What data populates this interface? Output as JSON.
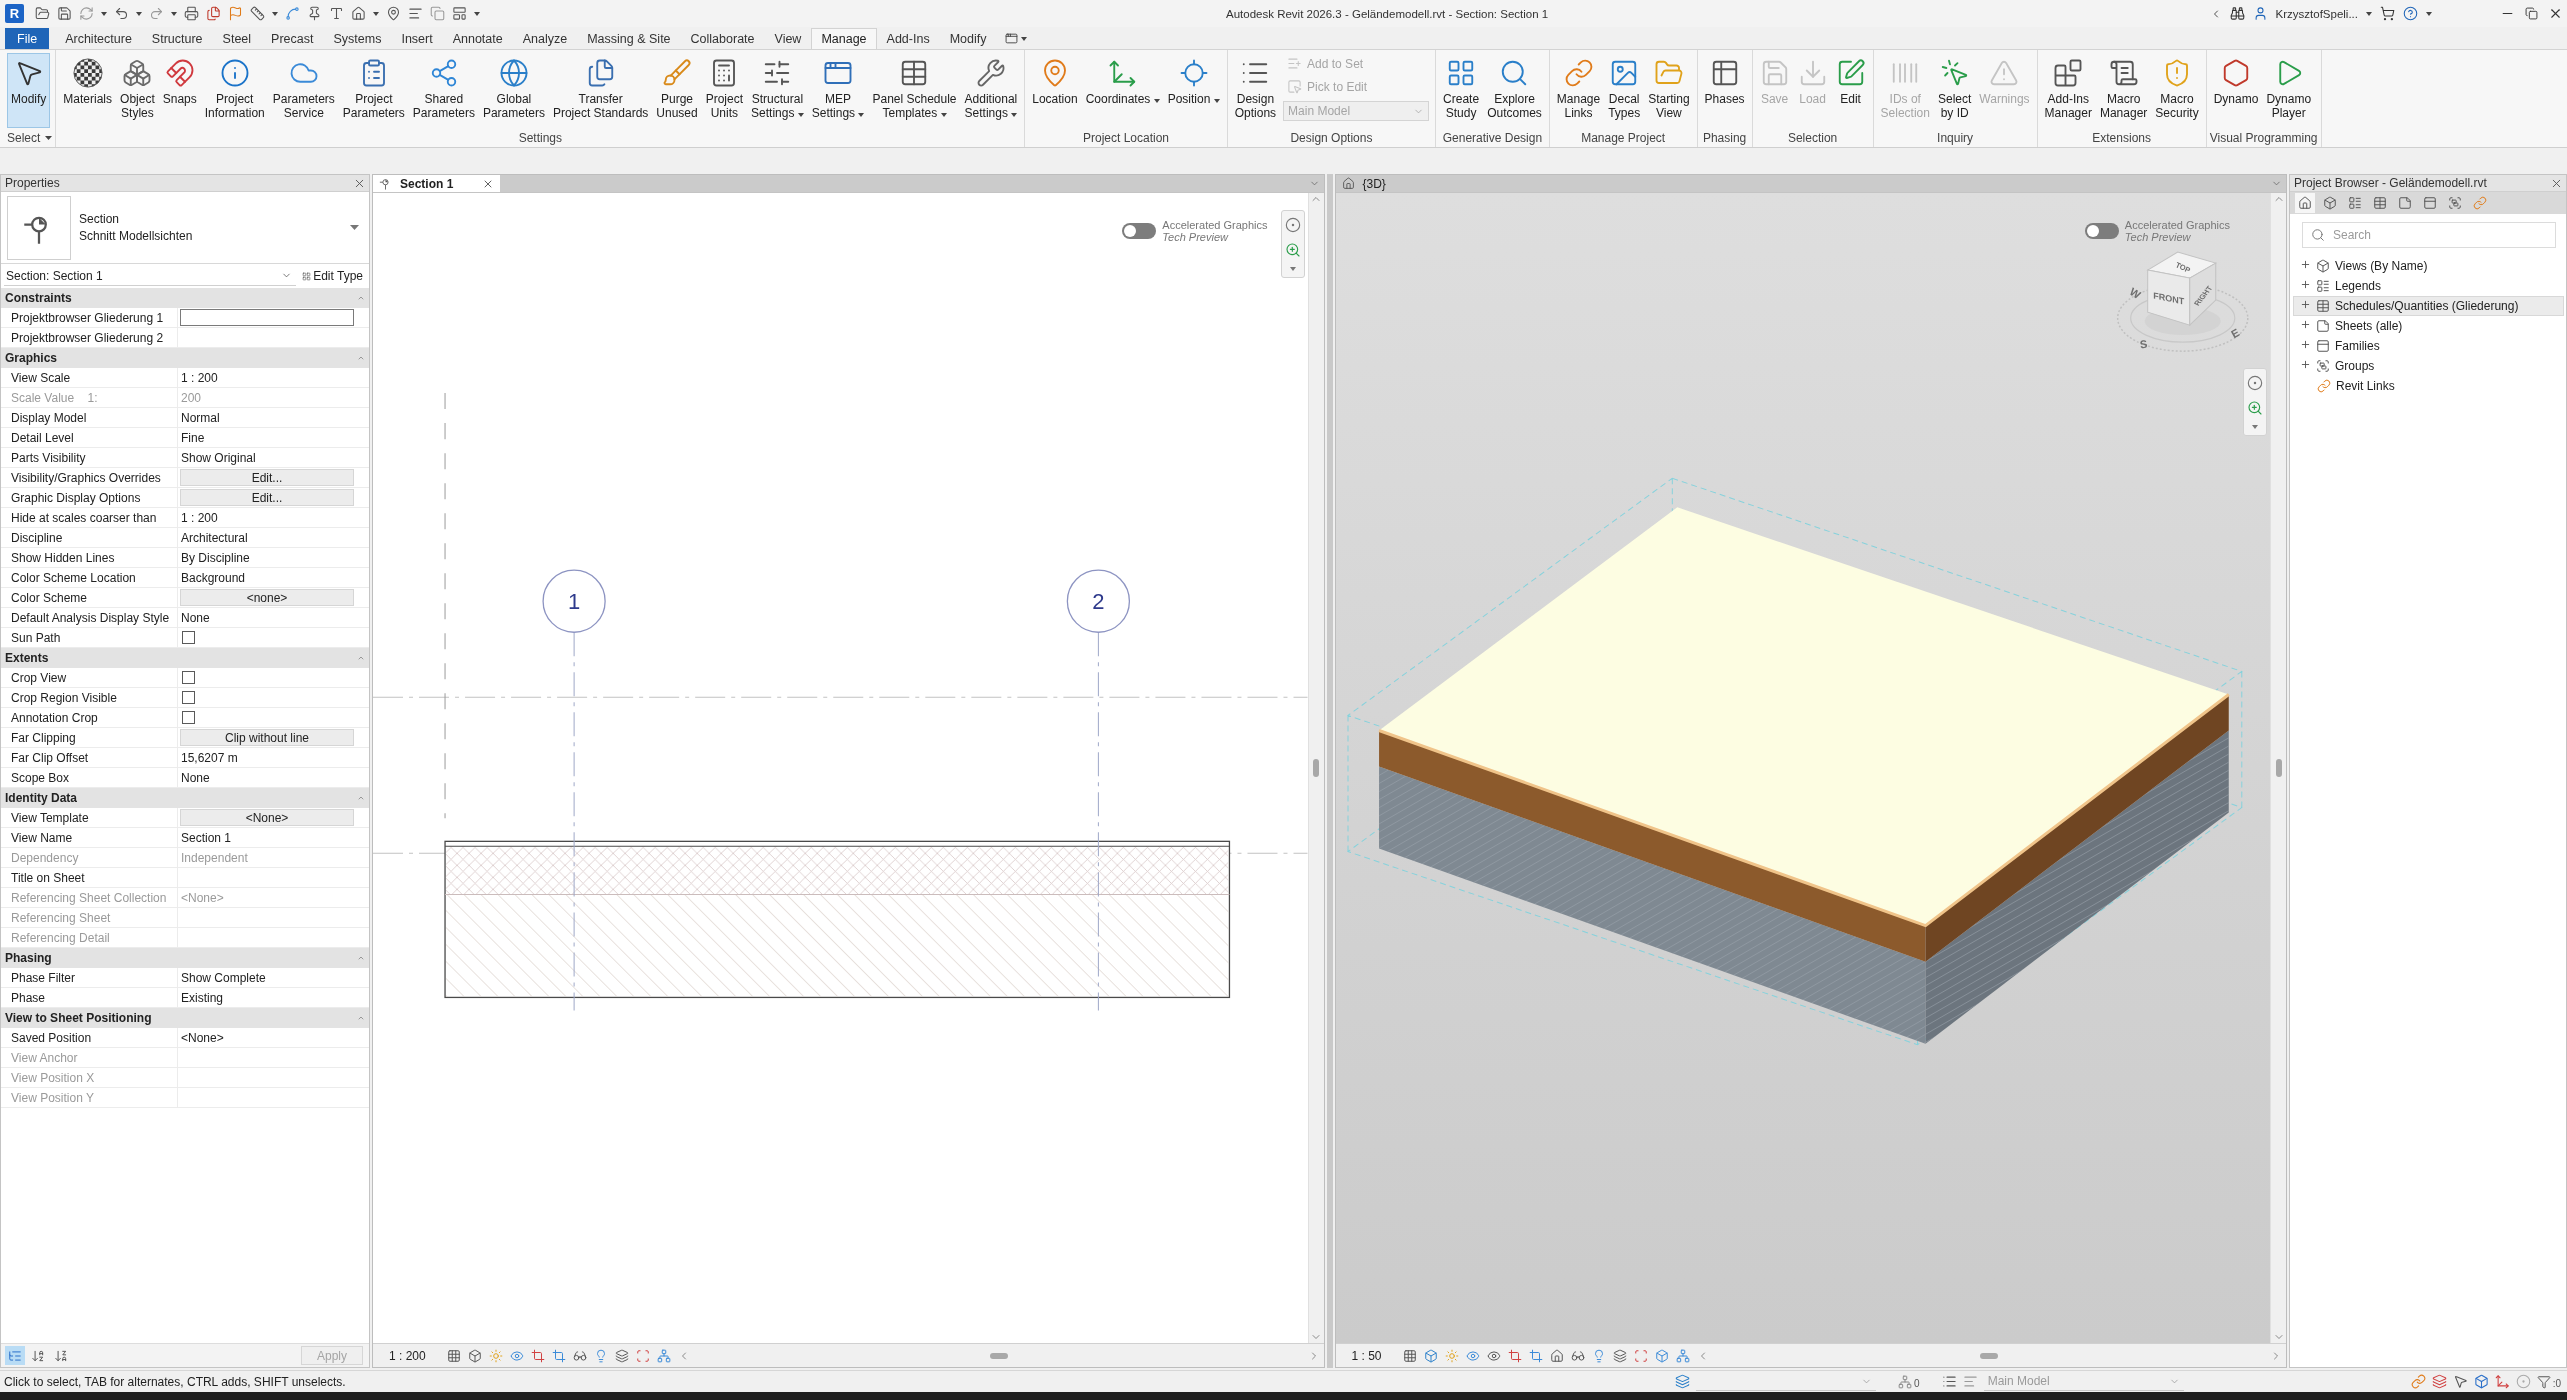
{
  "title_bar": {
    "logo": "R",
    "title": "Autodesk Revit 2026.3 - Geländemodell.rvt - Section: Section 1",
    "user": "KrzysztofSpeli..."
  },
  "ribbon_tabs": [
    {
      "label": "File",
      "kind": "file",
      "selected": false
    },
    {
      "label": "Architecture",
      "kind": "tab",
      "selected": false
    },
    {
      "label": "Structure",
      "kind": "tab",
      "selected": false
    },
    {
      "label": "Steel",
      "kind": "tab",
      "selected": false
    },
    {
      "label": "Precast",
      "kind": "tab",
      "selected": false
    },
    {
      "label": "Systems",
      "kind": "tab",
      "selected": false
    },
    {
      "label": "Insert",
      "kind": "tab",
      "selected": false
    },
    {
      "label": "Annotate",
      "kind": "tab",
      "selected": false
    },
    {
      "label": "Analyze",
      "kind": "tab",
      "selected": false
    },
    {
      "label": "Massing & Site",
      "kind": "tab",
      "selected": false
    },
    {
      "label": "Collaborate",
      "kind": "tab",
      "selected": false
    },
    {
      "label": "View",
      "kind": "tab",
      "selected": false
    },
    {
      "label": "Manage",
      "kind": "tab",
      "selected": true
    },
    {
      "label": "Add-Ins",
      "kind": "tab",
      "selected": false
    },
    {
      "label": "Modify",
      "kind": "tab",
      "selected": false
    }
  ],
  "ribbon_panels": [
    {
      "title": "Select",
      "menu": true,
      "buttons": [
        {
          "label": "Modify",
          "kind": "large",
          "active": true,
          "disabled": false,
          "dropdown": false
        }
      ]
    },
    {
      "title": "Settings",
      "menu": false,
      "buttons": [
        {
          "label": "Materials",
          "kind": "large",
          "active": false,
          "disabled": false,
          "dropdown": false
        },
        {
          "label": "Object\nStyles",
          "kind": "large",
          "active": false,
          "disabled": false,
          "dropdown": false
        },
        {
          "label": "Snaps",
          "kind": "large",
          "active": false,
          "disabled": false,
          "dropdown": false
        },
        {
          "label": "Project\nInformation",
          "kind": "large",
          "active": false,
          "disabled": false,
          "dropdown": false
        },
        {
          "label": "Parameters\nService",
          "kind": "large",
          "active": false,
          "disabled": false,
          "dropdown": false
        },
        {
          "label": "Project\nParameters",
          "kind": "large",
          "active": false,
          "disabled": false,
          "dropdown": false
        },
        {
          "label": "Shared\nParameters",
          "kind": "large",
          "active": false,
          "disabled": false,
          "dropdown": false
        },
        {
          "label": "Global\nParameters",
          "kind": "large",
          "active": false,
          "disabled": false,
          "dropdown": false
        },
        {
          "label": "Transfer\nProject Standards",
          "kind": "large",
          "active": false,
          "disabled": false,
          "dropdown": false
        },
        {
          "label": "Purge\nUnused",
          "kind": "large",
          "active": false,
          "disabled": false,
          "dropdown": false
        },
        {
          "label": "Project\nUnits",
          "kind": "large",
          "active": false,
          "disabled": false,
          "dropdown": false
        },
        {
          "label": "Structural\nSettings",
          "kind": "large",
          "active": false,
          "disabled": false,
          "dropdown": true
        },
        {
          "label": "MEP\nSettings",
          "kind": "large",
          "active": false,
          "disabled": false,
          "dropdown": true
        },
        {
          "label": "Panel Schedule\nTemplates",
          "kind": "large",
          "active": false,
          "disabled": false,
          "dropdown": true
        },
        {
          "label": "Additional\nSettings",
          "kind": "large",
          "active": false,
          "disabled": false,
          "dropdown": true
        }
      ]
    },
    {
      "title": "Project Location",
      "menu": false,
      "buttons": [
        {
          "label": "Location",
          "kind": "large",
          "active": false,
          "disabled": false,
          "dropdown": false
        },
        {
          "label": "Coordinates",
          "kind": "large",
          "active": false,
          "disabled": false,
          "dropdown": true
        },
        {
          "label": "Position",
          "kind": "large",
          "active": false,
          "disabled": false,
          "dropdown": true
        }
      ]
    },
    {
      "title": "Design Options",
      "menu": false,
      "buttons": [
        {
          "label": "Design\nOptions",
          "kind": "large",
          "active": false,
          "disabled": false,
          "dropdown": false
        },
        {
          "label": "Add to Set",
          "kind": "small",
          "active": false,
          "disabled": true,
          "dropdown": false
        },
        {
          "label": "Pick to Edit",
          "kind": "small",
          "active": false,
          "disabled": true,
          "dropdown": false
        },
        {
          "label": "Main Model",
          "kind": "field",
          "disabled": true,
          "dropdown": true
        }
      ]
    },
    {
      "title": "Generative Design",
      "menu": false,
      "buttons": [
        {
          "label": "Create\nStudy",
          "kind": "large",
          "active": false,
          "disabled": false,
          "dropdown": false
        },
        {
          "label": "Explore\nOutcomes",
          "kind": "large",
          "active": false,
          "disabled": false,
          "dropdown": false
        }
      ]
    },
    {
      "title": "Manage Project",
      "menu": false,
      "buttons": [
        {
          "label": "Manage\nLinks",
          "kind": "large",
          "active": false,
          "disabled": false,
          "dropdown": false
        },
        {
          "label": "Decal\nTypes",
          "kind": "large",
          "active": false,
          "disabled": false,
          "dropdown": false
        },
        {
          "label": "Starting\nView",
          "kind": "large",
          "active": false,
          "disabled": false,
          "dropdown": false
        }
      ]
    },
    {
      "title": "Phasing",
      "menu": false,
      "buttons": [
        {
          "label": "Phases",
          "kind": "large",
          "active": false,
          "disabled": false,
          "dropdown": false
        }
      ]
    },
    {
      "title": "Selection",
      "menu": false,
      "buttons": [
        {
          "label": "Save",
          "kind": "large",
          "active": false,
          "disabled": true,
          "dropdown": false
        },
        {
          "label": "Load",
          "kind": "large",
          "active": false,
          "disabled": true,
          "dropdown": false
        },
        {
          "label": "Edit",
          "kind": "large",
          "active": false,
          "disabled": false,
          "dropdown": false
        }
      ]
    },
    {
      "title": "Inquiry",
      "menu": false,
      "buttons": [
        {
          "label": "IDs of\nSelection",
          "kind": "large",
          "active": false,
          "disabled": true,
          "dropdown": false
        },
        {
          "label": "Select\nby ID",
          "kind": "large",
          "active": false,
          "disabled": false,
          "dropdown": false
        },
        {
          "label": "Warnings",
          "kind": "large",
          "active": false,
          "disabled": true,
          "dropdown": false
        }
      ]
    },
    {
      "title": "Extensions",
      "menu": false,
      "buttons": [
        {
          "label": "Add-Ins\nManager",
          "kind": "large",
          "active": false,
          "disabled": false,
          "dropdown": false
        },
        {
          "label": "Macro\nManager",
          "kind": "large",
          "active": false,
          "disabled": false,
          "dropdown": false
        },
        {
          "label": "Macro\nSecurity",
          "kind": "large",
          "active": false,
          "disabled": false,
          "dropdown": false
        }
      ]
    },
    {
      "title": "Visual Programming",
      "menu": false,
      "buttons": [
        {
          "label": "Dynamo",
          "kind": "large",
          "active": false,
          "disabled": false,
          "dropdown": false
        },
        {
          "label": "Dynamo\nPlayer",
          "kind": "large",
          "active": false,
          "disabled": false,
          "dropdown": false
        }
      ]
    }
  ],
  "properties": {
    "title": "Properties",
    "type_family": "Section",
    "type_name": "Schnitt Modellsichten",
    "instance": "Section: Section 1",
    "edit_type": "Edit Type",
    "groups": [
      {
        "title": "Constraints",
        "rows": [
          {
            "name": "Projektbrowser Gliederung 1",
            "kind": "input",
            "disabled": false
          },
          {
            "name": "Projektbrowser Gliederung 2",
            "kind": "text",
            "disabled": false
          }
        ]
      },
      {
        "title": "Graphics",
        "rows": [
          {
            "name": "View Scale",
            "value": "1 : 200",
            "kind": "text",
            "disabled": false
          },
          {
            "name": "Scale Value    1:",
            "value": "200",
            "kind": "text",
            "disabled": true
          },
          {
            "name": "Display Model",
            "value": "Normal",
            "kind": "text",
            "disabled": false
          },
          {
            "name": "Detail Level",
            "value": "Fine",
            "kind": "text",
            "disabled": false
          },
          {
            "name": "Parts Visibility",
            "value": "Show Original",
            "kind": "text",
            "disabled": false
          },
          {
            "name": "Visibility/Graphics Overrides",
            "value": "Edit...",
            "kind": "button",
            "disabled": false
          },
          {
            "name": "Graphic Display Options",
            "value": "Edit...",
            "kind": "button",
            "disabled": false
          },
          {
            "name": "Hide at scales coarser than",
            "value": "1 : 200",
            "kind": "text",
            "disabled": false
          },
          {
            "name": "Discipline",
            "value": "Architectural",
            "kind": "text",
            "disabled": false
          },
          {
            "name": "Show Hidden Lines",
            "value": "By Discipline",
            "kind": "text",
            "disabled": false
          },
          {
            "name": "Color Scheme Location",
            "value": "Background",
            "kind": "text",
            "disabled": false
          },
          {
            "name": "Color Scheme",
            "value": "<none>",
            "kind": "button",
            "disabled": false
          },
          {
            "name": "Default Analysis Display Style",
            "value": "None",
            "kind": "text",
            "disabled": false
          },
          {
            "name": "Sun Path",
            "kind": "checkbox",
            "checked": false,
            "disabled": false
          }
        ]
      },
      {
        "title": "Extents",
        "rows": [
          {
            "name": "Crop View",
            "kind": "checkbox",
            "checked": false,
            "disabled": false
          },
          {
            "name": "Crop Region Visible",
            "kind": "checkbox",
            "checked": false,
            "disabled": false
          },
          {
            "name": "Annotation Crop",
            "kind": "checkbox",
            "checked": false,
            "disabled": false
          },
          {
            "name": "Far Clipping",
            "value": "Clip without line",
            "kind": "button",
            "disabled": false
          },
          {
            "name": "Far Clip Offset",
            "value": "15,6207 m",
            "kind": "text",
            "disabled": false
          },
          {
            "name": "Scope Box",
            "value": "None",
            "kind": "text",
            "disabled": false
          }
        ]
      },
      {
        "title": "Identity Data",
        "rows": [
          {
            "name": "View Template",
            "value": "<None>",
            "kind": "button",
            "disabled": false
          },
          {
            "name": "View Name",
            "value": "Section 1",
            "kind": "text",
            "disabled": false
          },
          {
            "name": "Dependency",
            "value": "Independent",
            "kind": "text",
            "disabled": true
          },
          {
            "name": "Title on Sheet",
            "kind": "text",
            "disabled": false
          },
          {
            "name": "Referencing Sheet Collection",
            "value": "<None>",
            "kind": "text",
            "disabled": true
          },
          {
            "name": "Referencing Sheet",
            "kind": "text",
            "disabled": true
          },
          {
            "name": "Referencing Detail",
            "kind": "text",
            "disabled": true
          }
        ]
      },
      {
        "title": "Phasing",
        "rows": [
          {
            "name": "Phase Filter",
            "value": "Show Complete",
            "kind": "text",
            "disabled": false
          },
          {
            "name": "Phase",
            "value": "Existing",
            "kind": "text",
            "disabled": false
          }
        ]
      },
      {
        "title": "View to Sheet Positioning",
        "rows": [
          {
            "name": "Saved Position",
            "value": "<None>",
            "kind": "text",
            "disabled": false
          },
          {
            "name": "View Anchor",
            "kind": "text",
            "disabled": true
          },
          {
            "name": "View Position X",
            "kind": "text",
            "disabled": true
          },
          {
            "name": "View Position Y",
            "kind": "text",
            "disabled": true
          }
        ]
      }
    ],
    "sort_buttons": [
      {
        "selected": true
      },
      {
        "selected": false
      },
      {
        "selected": false
      }
    ],
    "apply": {
      "label": "Apply",
      "disabled": true
    }
  },
  "section_view": {
    "tab": {
      "label": "Section 1",
      "selected": true
    },
    "toggle": {
      "label": "Accelerated Graphics",
      "sublabel": "Tech Preview",
      "on": false
    },
    "grids": [
      {
        "label": "1"
      },
      {
        "label": "2"
      }
    ],
    "scale": "1 : 200"
  },
  "view_3d": {
    "tab": {
      "label": "{3D}",
      "selected": false
    },
    "toggle": {
      "label": "Accelerated Graphics",
      "sublabel": "Tech Preview",
      "on": false
    },
    "viewcube": {
      "faces": [
        "TOP",
        "FRONT",
        "RIGHT"
      ],
      "compass": [
        "W",
        "S",
        "E"
      ]
    },
    "scale": "1 : 50"
  },
  "project_browser": {
    "title": "Project Browser - Geländemodell.rvt",
    "toolbar": [
      {
        "selected": true
      },
      {
        "selected": false
      },
      {
        "selected": false
      },
      {
        "selected": false
      },
      {
        "selected": false
      },
      {
        "selected": false
      },
      {
        "selected": false
      },
      {
        "selected": false
      }
    ],
    "search": {
      "placeholder": "Search"
    },
    "items": [
      {
        "label": "Views (By Name)",
        "kind": "folder",
        "expanded": false,
        "selected": false
      },
      {
        "label": "Legends",
        "kind": "folder",
        "expanded": false,
        "selected": false
      },
      {
        "label": "Schedules/Quantities (Gliederung)",
        "kind": "folder",
        "expanded": false,
        "selected": true
      },
      {
        "label": "Sheets (alle)",
        "kind": "folder",
        "expanded": false,
        "selected": false
      },
      {
        "label": "Families",
        "kind": "folder",
        "expanded": false,
        "selected": false
      },
      {
        "label": "Groups",
        "kind": "folder",
        "expanded": false,
        "selected": false
      },
      {
        "label": "Revit Links",
        "kind": "link",
        "selected": false
      }
    ]
  },
  "status_bar": {
    "message": "Click to select, TAB for alternates, CTRL adds, SHIFT unselects.",
    "editing_requests": "0",
    "design_option": "Main Model",
    "filter_count": ":0"
  }
}
